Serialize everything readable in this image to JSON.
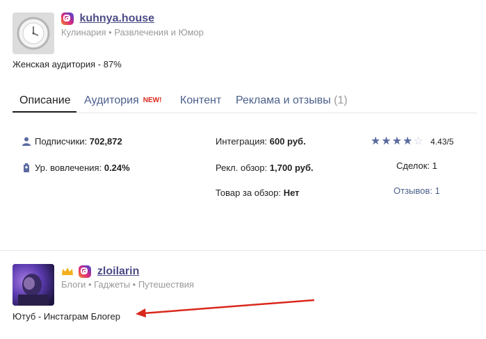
{
  "card1": {
    "handle": "kuhnya.house",
    "categories": "Кулинария • Развлечения и Юмор",
    "audience": "Женская аудитория - 87%",
    "tabs": [
      {
        "label": "Описание"
      },
      {
        "label": "Аудитория",
        "badge": "NEW!"
      },
      {
        "label": "Контент"
      },
      {
        "label": "Реклама и отзывы",
        "count": "(1)"
      }
    ],
    "stats": {
      "subscribers_label": "Подписчики:",
      "subscribers_value": "702,872",
      "engagement_label": "Ур. вовлечения:",
      "engagement_value": "0.24%",
      "integration_label": "Интеграция:",
      "integration_value": "600 руб.",
      "review_label": "Рекл. обзор:",
      "review_value": "1,700 руб.",
      "product_label": "Товар за обзор:",
      "product_value": "Нет"
    },
    "rating": {
      "stars_filled": 4,
      "stars_total": 5,
      "value_text": "4.43/5"
    },
    "deals": "Сделок: 1",
    "reviews_link": "Отзывов: 1"
  },
  "card2": {
    "handle": "zloilarin",
    "categories": "Блоги • Гаджеты • Путешествия",
    "description": "Ютуб - Инстаграм Блогер"
  },
  "colors": {
    "link": "#4b5f8a",
    "handle": "#4b4b86",
    "new_badge": "#d9281c",
    "arrow": "#d9281c"
  }
}
